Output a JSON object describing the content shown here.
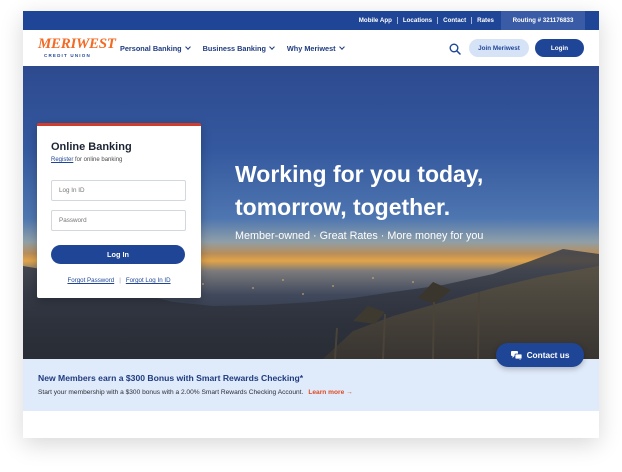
{
  "utility_bar": {
    "links": [
      "Mobile App",
      "Locations",
      "Contact",
      "Rates"
    ],
    "routing": "Routing # 321176833"
  },
  "header": {
    "logo_text": "MERIWEST",
    "logo_subtext": "CREDIT UNION",
    "nav": [
      "Personal Banking",
      "Business Banking",
      "Why Meriwest"
    ],
    "join_label": "Join Meriwest",
    "login_label": "Login"
  },
  "hero": {
    "title_line1": "Working for you today,",
    "title_line2": "tomorrow, together.",
    "subtitle": "Member-owned · Great Rates · More money for you"
  },
  "login_card": {
    "title": "Online Banking",
    "register_link": "Register",
    "register_suffix": " for online banking",
    "user_placeholder": "Log In ID",
    "pass_placeholder": "Password",
    "login_button": "Log In",
    "forgot_password": "Forgot Password",
    "forgot_id": "Forgot Log In ID"
  },
  "contact": {
    "label": "Contact us"
  },
  "promo": {
    "title": "New Members earn a $300 Bonus with Smart Rewards Checking*",
    "text": "Start your membership with a $300 bonus with a 2.00% Smart Rewards Checking Account.",
    "link": "Learn more →"
  },
  "colors": {
    "brand_blue": "#1f4597",
    "accent_orange": "#f26a23",
    "card_accent_red": "#d13d2a",
    "promo_background": "#dfeafa"
  },
  "icons": [
    "search-icon",
    "chevron-down-icon",
    "chat-icon",
    "arrow-right-icon"
  ]
}
